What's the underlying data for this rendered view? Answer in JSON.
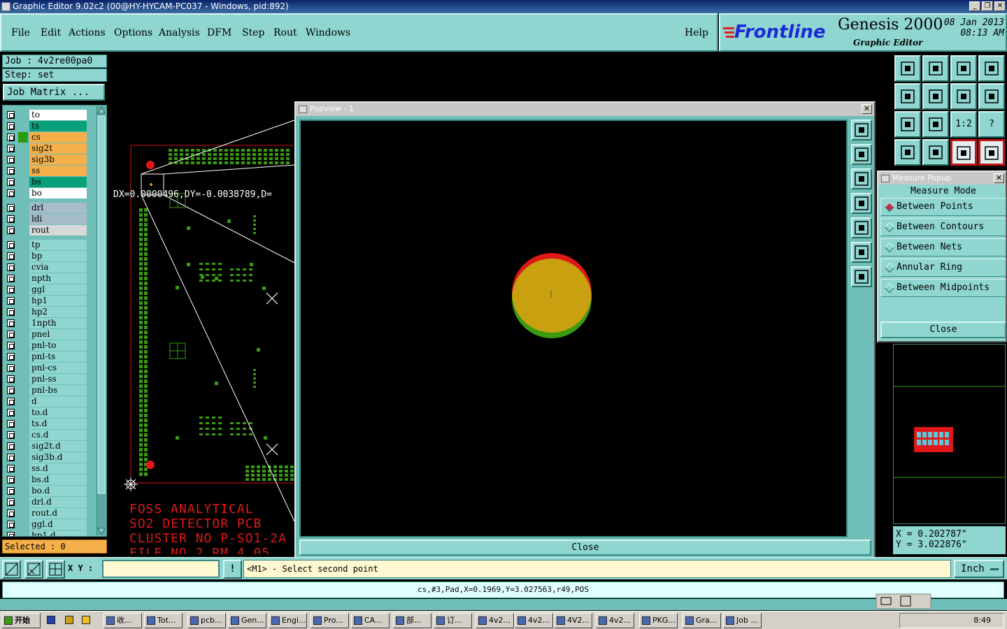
{
  "window": {
    "title": "Graphic Editor 9.02c2 (00@HY-HYCAM-PC037 - Windows, pid:892)"
  },
  "menu": [
    "File",
    "Edit",
    "Actions",
    "Options",
    "Analysis",
    "DFM",
    "Step",
    "Rout",
    "Windows"
  ],
  "help": "Help",
  "brand": {
    "logo": "Frontline",
    "product": "Genesis 2000",
    "subtitle": "Graphic Editor",
    "date": "08 Jan 2013",
    "time": "08:13 AM"
  },
  "job": {
    "job": "Job : 4v2re00pa0",
    "step": "Step: set",
    "matrix_button": "Job Matrix ..."
  },
  "layers": [
    {
      "name": "to",
      "color": "#ffffff"
    },
    {
      "name": "ts",
      "color": "#0aa07a"
    },
    {
      "name": "cs",
      "color": "#f5b04a"
    },
    {
      "name": "sig2t",
      "color": "#f5b04a"
    },
    {
      "name": "sig3b",
      "color": "#f5b04a"
    },
    {
      "name": "ss",
      "color": "#f5b04a"
    },
    {
      "name": "bs",
      "color": "#0aa07a"
    },
    {
      "name": "bo",
      "color": "#ffffff"
    },
    {
      "name": "drl",
      "color": "#a6bcc8"
    },
    {
      "name": "ldi",
      "color": "#a6bcc8"
    },
    {
      "name": "rout",
      "color": "#d8d8d8"
    },
    {
      "name": "tp",
      "color": "#8fd6d0"
    },
    {
      "name": "bp",
      "color": "#8fd6d0"
    },
    {
      "name": "cvia",
      "color": "#8fd6d0"
    },
    {
      "name": "npth",
      "color": "#8fd6d0"
    },
    {
      "name": "ggl",
      "color": "#8fd6d0"
    },
    {
      "name": "hp1",
      "color": "#8fd6d0"
    },
    {
      "name": "hp2",
      "color": "#8fd6d0"
    },
    {
      "name": "1npth",
      "color": "#8fd6d0"
    },
    {
      "name": "pnel",
      "color": "#8fd6d0"
    },
    {
      "name": "pnl-to",
      "color": "#8fd6d0"
    },
    {
      "name": "pnl-ts",
      "color": "#8fd6d0"
    },
    {
      "name": "pnl-cs",
      "color": "#8fd6d0"
    },
    {
      "name": "pnl-ss",
      "color": "#8fd6d0"
    },
    {
      "name": "pnl-bs",
      "color": "#8fd6d0"
    },
    {
      "name": "d",
      "color": "#8fd6d0"
    },
    {
      "name": "to.d",
      "color": "#8fd6d0"
    },
    {
      "name": "ts.d",
      "color": "#8fd6d0"
    },
    {
      "name": "cs.d",
      "color": "#8fd6d0"
    },
    {
      "name": "sig2t.d",
      "color": "#8fd6d0"
    },
    {
      "name": "sig3b.d",
      "color": "#8fd6d0"
    },
    {
      "name": "ss.d",
      "color": "#8fd6d0"
    },
    {
      "name": "bs.d",
      "color": "#8fd6d0"
    },
    {
      "name": "bo.d",
      "color": "#8fd6d0"
    },
    {
      "name": "drl.d",
      "color": "#8fd6d0"
    },
    {
      "name": "rout.d",
      "color": "#8fd6d0"
    },
    {
      "name": "ggl.d",
      "color": "#8fd6d0"
    },
    {
      "name": "hp1.d",
      "color": "#8fd6d0"
    }
  ],
  "selected": "Selected : 0",
  "measure_readout": "DX=0.0000496,DY=-0.0038789,D=",
  "board_text": [
    "FOSS ANALYTICAL",
    "SO2 DETECTOR PCB",
    "CLUSTER NO P-SO1-2A",
    "FILE NO 2 RM 4.05"
  ],
  "popview": {
    "title": "Popview - 1",
    "close": "Close",
    "close_x": "✕"
  },
  "tool_labels": {
    "ratio": "1:2",
    "help": "?"
  },
  "measure_popup": {
    "title": "Measure Popup",
    "header": "Measure Mode",
    "options": [
      "Between Points",
      "Between Contours",
      "Between Nets",
      "Annular Ring",
      "Between Midpoints"
    ],
    "selected_option": "Between Points",
    "close": "Close"
  },
  "coords": {
    "x": "X = 0.202787\"",
    "y": "Y = 3.022876\""
  },
  "command": {
    "xy_label": "X Y :",
    "xy_value": "",
    "warn": "!",
    "prompt": "<M1> - Select second point",
    "units": "Inch"
  },
  "status_line": "cs,#3,Pad,X=0.1969,Y=3.027563,r49,POS",
  "taskbar": {
    "start": "开始",
    "items": [
      "收...",
      "Tot...",
      "pcb...",
      "Gen...",
      "Engi...",
      "Pro...",
      "CA...",
      "部...",
      "订...",
      "4v2...",
      "4v2...",
      "4V2...",
      "4v2...",
      "PKG...",
      "Gra...",
      "Job ..."
    ],
    "clock": "8:49"
  },
  "colors": {
    "panel": "#8fd6d0",
    "pad_red": "#e01818",
    "pad_green": "#3a9a10",
    "pad_overlap": "#c8a010"
  }
}
